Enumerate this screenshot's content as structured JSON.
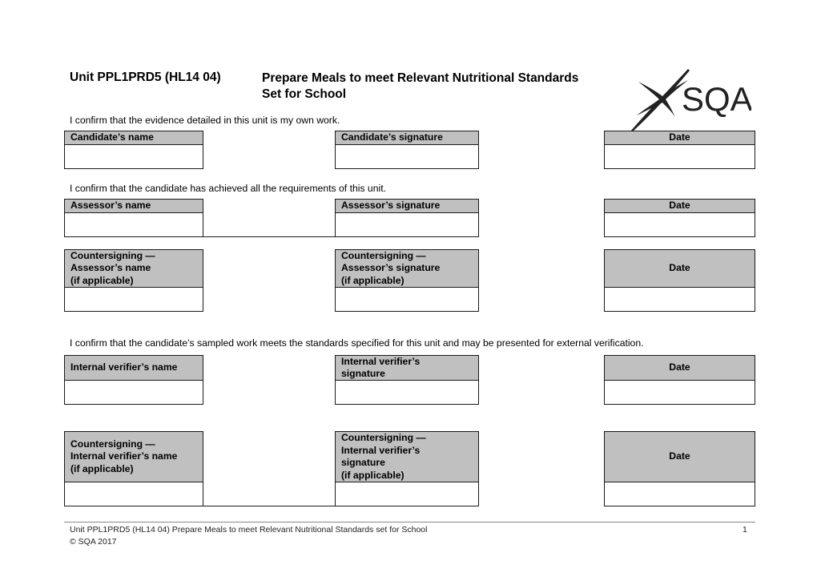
{
  "header": {
    "unit_code": "Unit PPL1PRD5 (HL14 04)",
    "unit_title_line1": "Prepare Meals to meet Relevant Nutritional Standards",
    "unit_title_line2": "Set for School",
    "logo_text": "SQA",
    "logo_icon": "sqa-saltire-logo"
  },
  "sections": {
    "candidate": {
      "statement": "I confirm that the evidence detailed in this unit is my own work.",
      "name_label": "Candidate’s name",
      "signature_label": "Candidate’s signature",
      "date_label": "Date",
      "name_value": "",
      "signature_value": "",
      "date_value": ""
    },
    "assessor": {
      "statement": "I confirm that the candidate has achieved all the requirements of this unit.",
      "name_label": "Assessor’s name",
      "signature_label": "Assessor’s signature",
      "date_label": "Date",
      "name_value": "",
      "signature_value": "",
      "date_value": ""
    },
    "countersign_assessor": {
      "name_label_lines": [
        "Countersigning —",
        "Assessor’s name",
        "(if applicable)"
      ],
      "signature_label_lines": [
        "Countersigning —",
        "Assessor’s signature",
        "(if applicable)"
      ],
      "date_label": "Date",
      "name_value": "",
      "signature_value": "",
      "date_value": ""
    },
    "internal_verifier": {
      "statement": "I confirm that the candidate’s sampled work meets the standards specified for this unit and may be presented for external verification.",
      "name_label": "Internal verifier’s name",
      "signature_label_lines": [
        "Internal verifier’s",
        "signature"
      ],
      "date_label": "Date",
      "name_value": "",
      "signature_value": "",
      "date_value": ""
    },
    "countersign_iv": {
      "name_label_lines": [
        "Countersigning —",
        "Internal verifier’s name",
        "(if applicable)"
      ],
      "signature_label_lines": [
        "Countersigning —",
        "Internal verifier’s",
        "signature",
        "(if applicable)"
      ],
      "date_label": "Date",
      "name_value": "",
      "signature_value": "",
      "date_value": ""
    }
  },
  "footer": {
    "line1": "Unit PPL1PRD5 (HL14 04) Prepare Meals to meet Relevant Nutritional Standards set for School",
    "line2": "© SQA 2017",
    "page_number": "1"
  }
}
